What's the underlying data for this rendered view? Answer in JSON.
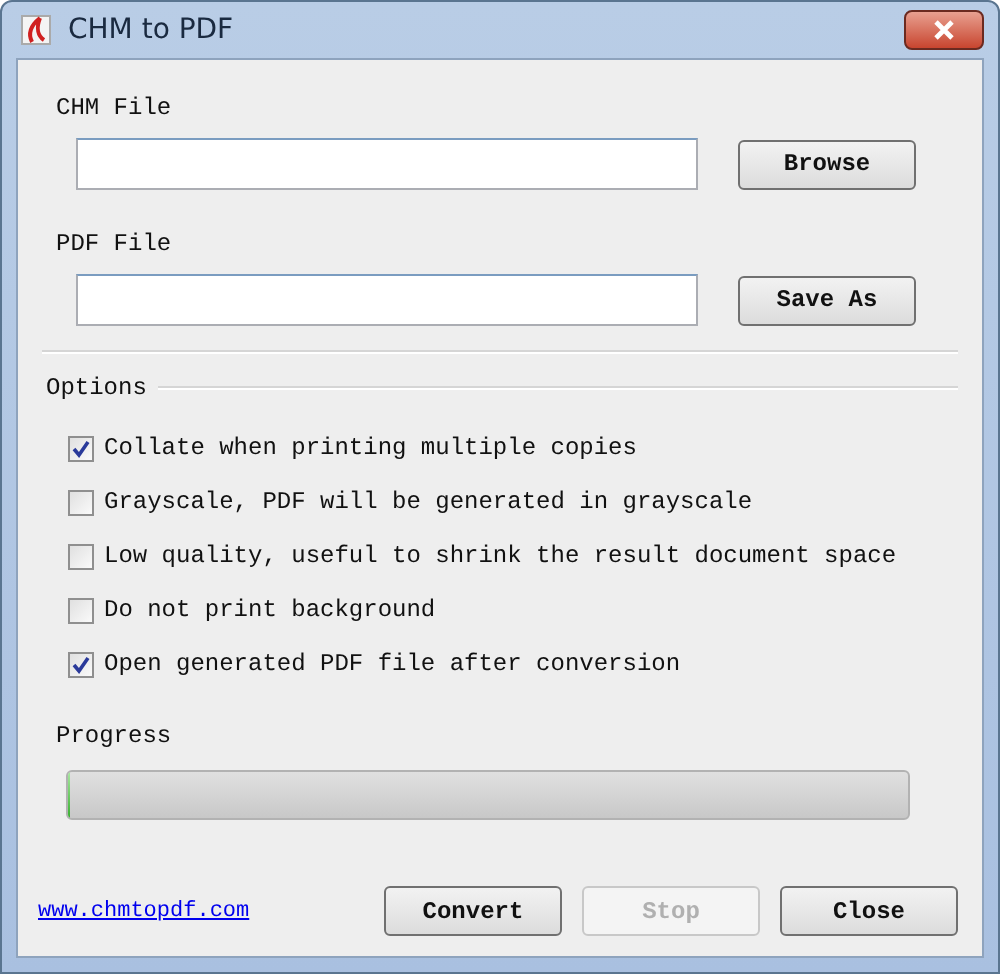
{
  "window": {
    "title": "CHM to PDF"
  },
  "chm_file": {
    "label": "CHM File",
    "button": "Browse"
  },
  "pdf_file": {
    "label": "PDF File",
    "button": "Save As"
  },
  "options": {
    "label": "Options",
    "items": [
      {
        "label": "Collate when printing multiple copies",
        "checked": true
      },
      {
        "label": "Grayscale, PDF will be generated in grayscale",
        "checked": false
      },
      {
        "label": "Low quality, useful to shrink the result document space",
        "checked": false
      },
      {
        "label": "Do not print background",
        "checked": false
      },
      {
        "label": "Open generated PDF file after conversion",
        "checked": true
      }
    ]
  },
  "progress": {
    "label": "Progress",
    "level": 0
  },
  "link": "www.chmtopdf.com",
  "buttons": [
    {
      "label": "Convert",
      "disabled": false
    },
    {
      "label": "Stop",
      "disabled": true
    },
    {
      "label": "Close",
      "disabled": false
    }
  ]
}
